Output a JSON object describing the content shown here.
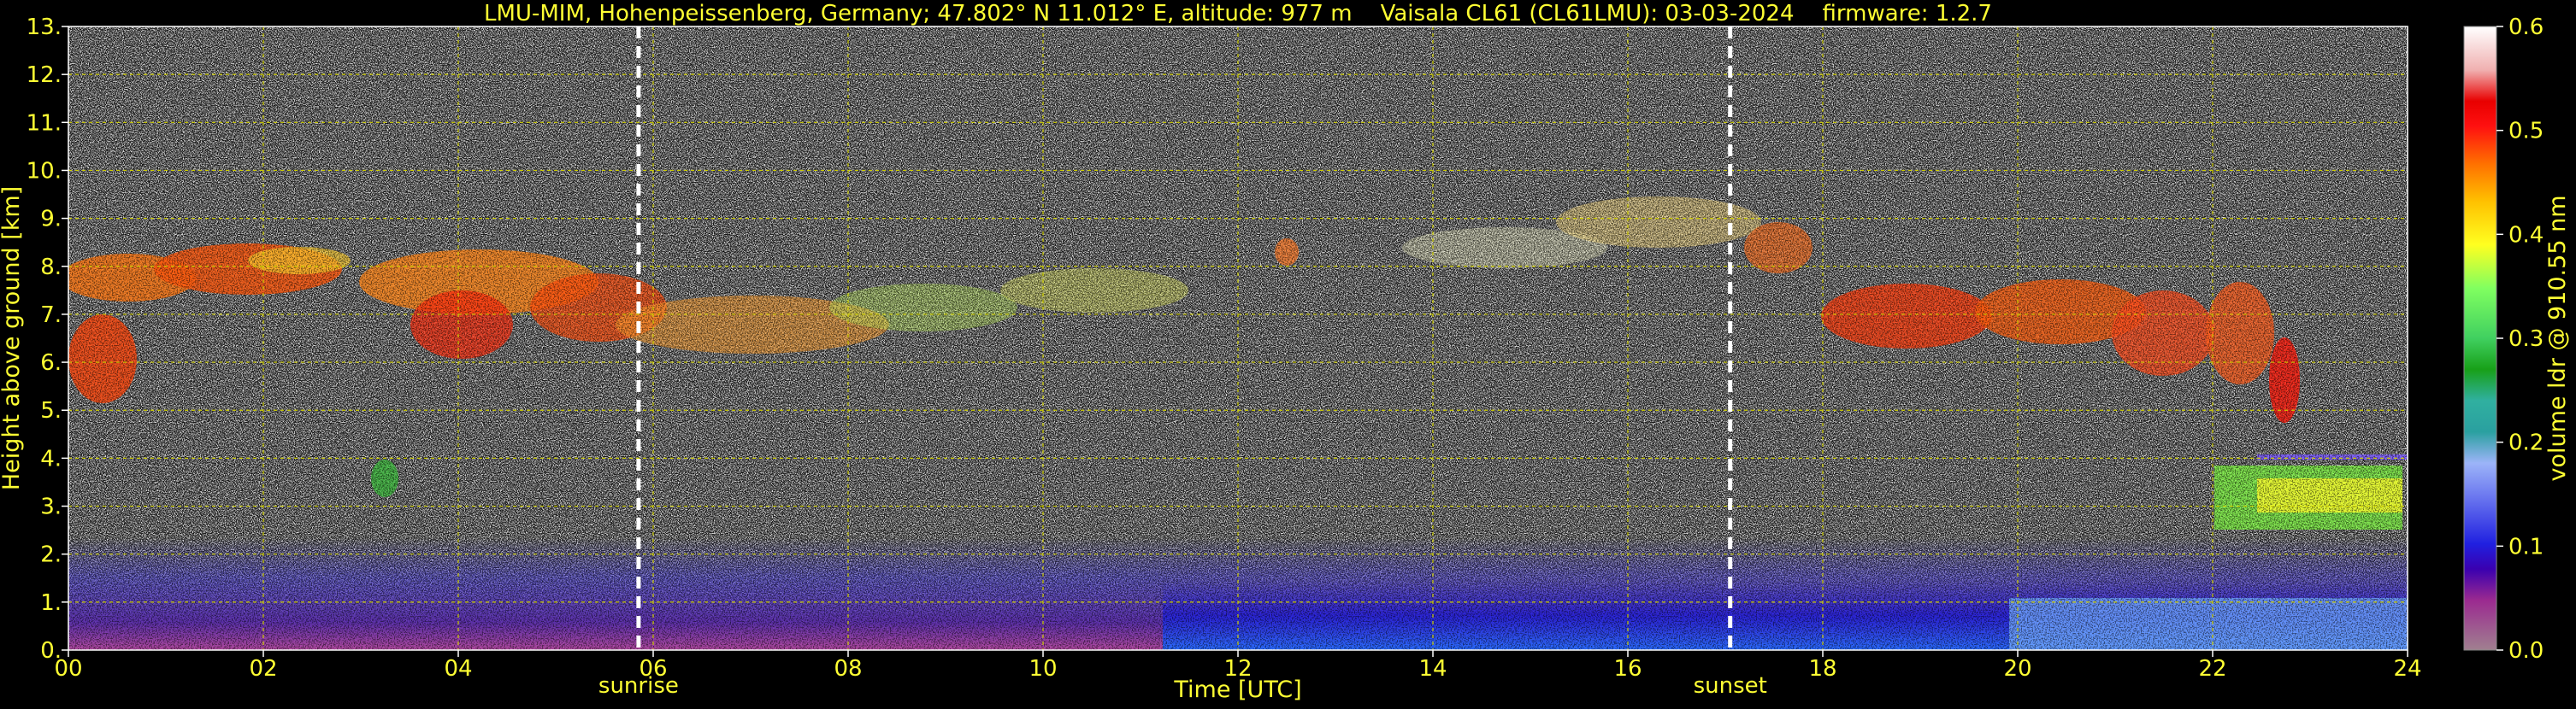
{
  "chart_data": {
    "type": "heatmap",
    "title": "LMU-MIM, Hohenpeissenberg, Germany; 47.802° N 11.012° E, altitude: 977 m    Vaisala CL61 (CL61LMU): 03-03-2024    firmware: 1.2.7",
    "xlabel": "Time [UTC]",
    "ylabel": "Height above ground [km]",
    "xlim": [
      0,
      24
    ],
    "ylim": [
      0,
      13
    ],
    "x_ticks": [
      "00",
      "02",
      "04",
      "06",
      "08",
      "10",
      "12",
      "14",
      "16",
      "18",
      "20",
      "22",
      "24"
    ],
    "y_ticks": [
      "0.",
      "1.",
      "2.",
      "3.",
      "4.",
      "5.",
      "6.",
      "7.",
      "8.",
      "9.",
      "10.",
      "11.",
      "12.",
      "13."
    ],
    "grid": true,
    "colorbar": {
      "label": "volume ldr @ 910.55 nm",
      "range": [
        0.0,
        0.6
      ],
      "ticks": [
        "0.0",
        "0.1",
        "0.2",
        "0.3",
        "0.4",
        "0.5",
        "0.6"
      ]
    },
    "markers": [
      {
        "label": "sunrise",
        "time": 5.85
      },
      {
        "label": "sunset",
        "time": 17.05
      }
    ],
    "colors": {
      "background": "#000000",
      "text": "#ffff33",
      "grid": "#cccc00",
      "marker_line": "#ffffff"
    }
  }
}
